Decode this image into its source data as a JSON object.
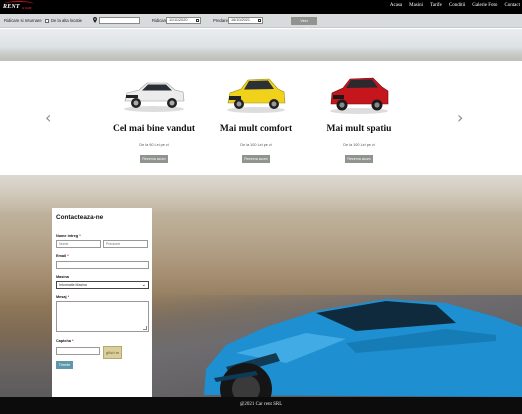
{
  "brand": {
    "logo_text": "RENT",
    "logo_sub": "A CAR"
  },
  "nav": [
    "Acasa",
    "Masini",
    "Tarife",
    "Conditii",
    "Galerie Foto",
    "Contact"
  ],
  "search": {
    "return_label": "Ridicare si returnare",
    "other_location_label": "De la alta locatie",
    "pickup_label": "Ridicare",
    "pickup_date": "11/11/2020",
    "return_label2": "Predare",
    "return_date": "16/10/2021",
    "button": "Vezi disponibilitate"
  },
  "carousel": [
    {
      "title": "Cel mai bine vandut",
      "price": "De la 90 Lei pe zi",
      "button": "Rezerva acum",
      "car_color": "#e9e9e9"
    },
    {
      "title": "Mai mult comfort",
      "price": "De la 100 Lei pe zi",
      "button": "Rezerva acum",
      "car_color": "#f0d21a"
    },
    {
      "title": "Mai mult spatiu",
      "price": "De la 100 Lei pe zi",
      "button": "Rezerva acum",
      "car_color": "#c4161c"
    }
  ],
  "form": {
    "title": "Contacteaza-ne",
    "name_label": "Nume intreg",
    "first_placeholder": "Nume",
    "last_placeholder": "Prenume",
    "email_label": "Email",
    "masina_label": "Masina",
    "masina_value": "Informatie Masina",
    "mesaj_label": "Mesaj",
    "captcha_label": "Captcha",
    "captcha_text": "g5sh.tn",
    "submit": "Trimite",
    "required_mark": "*"
  },
  "footer": {
    "text": "@2021 Car rent SRL"
  },
  "colors": {
    "topbar": "#000000",
    "button_gray": "#8f948e",
    "submit_blue": "#5d97a9",
    "racecar": "#1e8fd0"
  }
}
